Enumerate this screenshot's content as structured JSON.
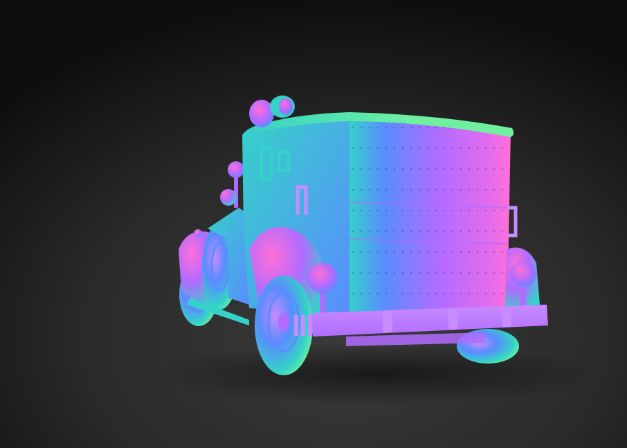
{
  "scene": {
    "subject": "vintage-armored-truck-normal-map-render",
    "view": "rear-three-quarter",
    "colors": {
      "background_top": "#0e0e0e",
      "background_mid": "#2a2a2a",
      "background_bottom": "#3a3a3a",
      "normal_blue": "#5a8cff",
      "normal_cyan": "#35d2c8",
      "normal_green": "#6ef0a0",
      "normal_purple": "#b06cff",
      "normal_magenta": "#e06cf0",
      "normal_pink": "#ff6fd8",
      "normal_lilac": "#c88cff"
    }
  }
}
